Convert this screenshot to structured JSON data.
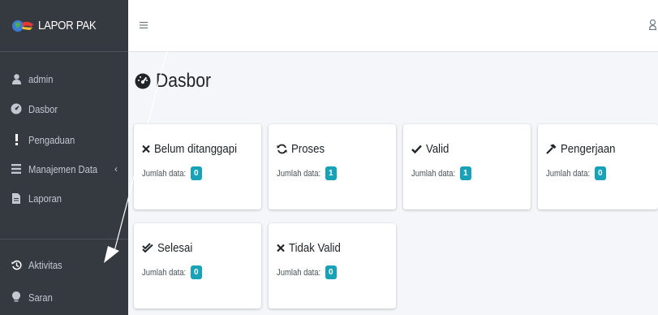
{
  "brand": {
    "name": "LAPOR PAK"
  },
  "sidebar": {
    "items": [
      {
        "label": "admin",
        "icon": "user-icon"
      },
      {
        "label": "Dasbor",
        "icon": "dashboard-icon"
      },
      {
        "label": "Pengaduan",
        "icon": "exclamation-icon"
      },
      {
        "label": "Manajemen Data",
        "icon": "list-icon",
        "caret": "‹"
      },
      {
        "label": "Laporan",
        "icon": "file-icon"
      },
      {
        "label": "Aktivitas",
        "icon": "history-icon"
      },
      {
        "label": "Saran",
        "icon": "lightbulb-icon"
      }
    ]
  },
  "topbar": {
    "menu_icon": "hamburger-icon",
    "user_icon": "user-icon"
  },
  "page": {
    "title": "Dasbor"
  },
  "cards": [
    {
      "title": "Belum ditanggapi",
      "icon": "times-icon",
      "sub_label": "Jumlah data:",
      "count": "0"
    },
    {
      "title": "Proses",
      "icon": "sync-icon",
      "sub_label": "Jumlah data:",
      "count": "1"
    },
    {
      "title": "Valid",
      "icon": "check-icon",
      "sub_label": "Jumlah data:",
      "count": "1"
    },
    {
      "title": "Pengerjaan",
      "icon": "hammer-icon",
      "sub_label": "Jumlah data:",
      "count": "0"
    },
    {
      "title": "Selesai",
      "icon": "check-double-icon",
      "sub_label": "Jumlah data:",
      "count": "0"
    },
    {
      "title": "Tidak Valid",
      "icon": "times-icon",
      "sub_label": "Jumlah data:",
      "count": "0"
    }
  ],
  "colors": {
    "sidebar_bg": "#343a40",
    "sidebar_text": "#c2c7d0",
    "content_bg": "#f4f6f9",
    "badge": "#17a2b8"
  }
}
